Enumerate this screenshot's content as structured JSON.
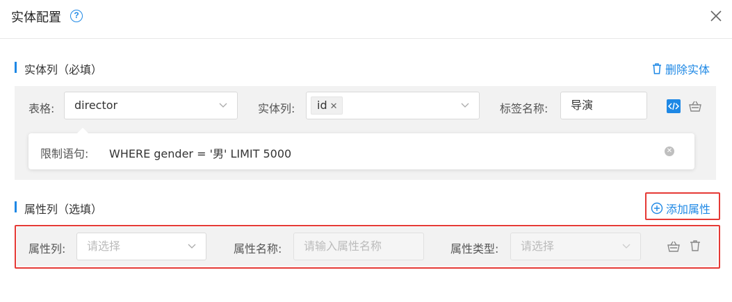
{
  "dialog": {
    "title": "实体配置",
    "help_icon": "question-circle-icon",
    "close_icon": "close-icon"
  },
  "entity_section": {
    "title": "实体列（必填）",
    "delete_label": "删除实体",
    "delete_icon": "trash-icon",
    "table_label": "表格:",
    "table_value": "director",
    "column_label": "实体列:",
    "column_tag": "id",
    "tag_name_label": "标签名称:",
    "tag_name_value": "导演",
    "code_icon": "code-icon",
    "basket_icon": "basket-icon",
    "limit_label": "限制语句:",
    "limit_value": "WHERE gender = '男' LIMIT 5000"
  },
  "attr_section": {
    "title": "属性列（选填）",
    "add_label": "添加属性",
    "add_icon": "plus-circle-icon",
    "attr_column_label": "属性列:",
    "attr_column_placeholder": "请选择",
    "attr_name_label": "属性名称:",
    "attr_name_placeholder": "请输入属性名称",
    "attr_type_label": "属性类型:",
    "attr_type_placeholder": "请选择",
    "basket_icon": "basket-icon",
    "trash_icon": "trash-icon"
  },
  "colors": {
    "accent": "#1e88e5",
    "highlight_border": "#e53935",
    "panel_bg": "#f2f2f2"
  }
}
